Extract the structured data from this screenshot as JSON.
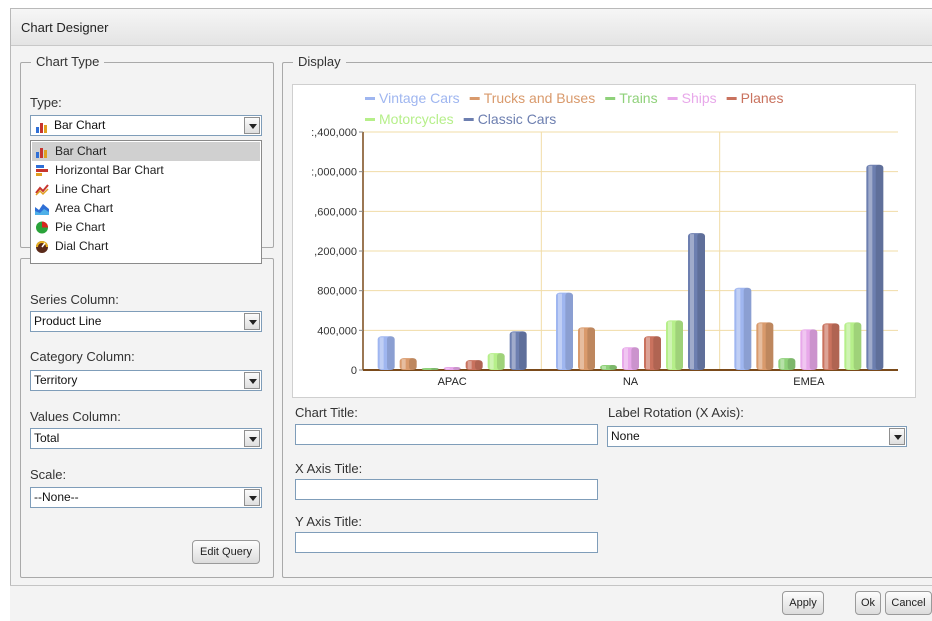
{
  "dialog": {
    "title": "Chart Designer"
  },
  "chart_type_group": {
    "legend": "Chart Type",
    "type_label": "Type:",
    "type_value": "Bar Chart",
    "options": [
      {
        "label": "Bar Chart",
        "icon": "bar-chart-icon",
        "selected": true
      },
      {
        "label": "Horizontal Bar Chart",
        "icon": "horizontal-bar-chart-icon",
        "selected": false
      },
      {
        "label": "Line Chart",
        "icon": "line-chart-icon",
        "selected": false
      },
      {
        "label": "Area Chart",
        "icon": "area-chart-icon",
        "selected": false
      },
      {
        "label": "Pie Chart",
        "icon": "pie-chart-icon",
        "selected": false
      },
      {
        "label": "Dial Chart",
        "icon": "dial-chart-icon",
        "selected": false
      }
    ]
  },
  "data_group": {
    "series_label": "Series Column:",
    "series_value": "Product Line",
    "category_label": "Category Column:",
    "category_value": "Territory",
    "values_label": "Values Column:",
    "values_value": "Total",
    "scale_label": "Scale:",
    "scale_value": "--None--",
    "edit_query": "Edit Query"
  },
  "display_group": {
    "legend": "Display",
    "chart_title_label": "Chart Title:",
    "chart_title_value": "",
    "label_rotation_label": "Label Rotation (X Axis):",
    "label_rotation_value": "None",
    "x_axis_title_label": "X Axis Title:",
    "x_axis_title_value": "",
    "y_axis_title_label": "Y Axis Title:",
    "y_axis_title_value": ""
  },
  "buttons": {
    "apply": "Apply",
    "ok": "Ok",
    "cancel": "Cancel"
  },
  "colors": {
    "Vintage Cars": "#9fb6f0",
    "Trucks and Buses": "#d99a6c",
    "Trains": "#8fd17a",
    "Ships": "#e8a8ea",
    "Planes": "#c9725e",
    "Motorcycles": "#b6ef8a",
    "Classic Cars": "#6d7fb0"
  },
  "chart_data": {
    "type": "bar",
    "categories": [
      "APAC",
      "NA",
      "EMEA"
    ],
    "y_tick_labels": [
      ":,400,000",
      ":,000,000",
      ",600,000",
      ",200,000",
      "800,000",
      "400,000",
      "0"
    ],
    "y_ticks": [
      2400000,
      2000000,
      1600000,
      1200000,
      800000,
      400000,
      0
    ],
    "ylim": [
      0,
      2400000
    ],
    "legend_placement": "top",
    "grid": true,
    "series": [
      {
        "name": "Vintage Cars",
        "values": [
          340000,
          780000,
          830000
        ]
      },
      {
        "name": "Trucks and Buses",
        "values": [
          120000,
          430000,
          480000
        ]
      },
      {
        "name": "Trains",
        "values": [
          10000,
          50000,
          120000
        ]
      },
      {
        "name": "Ships",
        "values": [
          30000,
          230000,
          410000
        ]
      },
      {
        "name": "Planes",
        "values": [
          100000,
          340000,
          470000
        ]
      },
      {
        "name": "Motorcycles",
        "values": [
          170000,
          500000,
          480000
        ]
      },
      {
        "name": "Classic Cars",
        "values": [
          390000,
          1380000,
          2070000
        ]
      }
    ]
  }
}
